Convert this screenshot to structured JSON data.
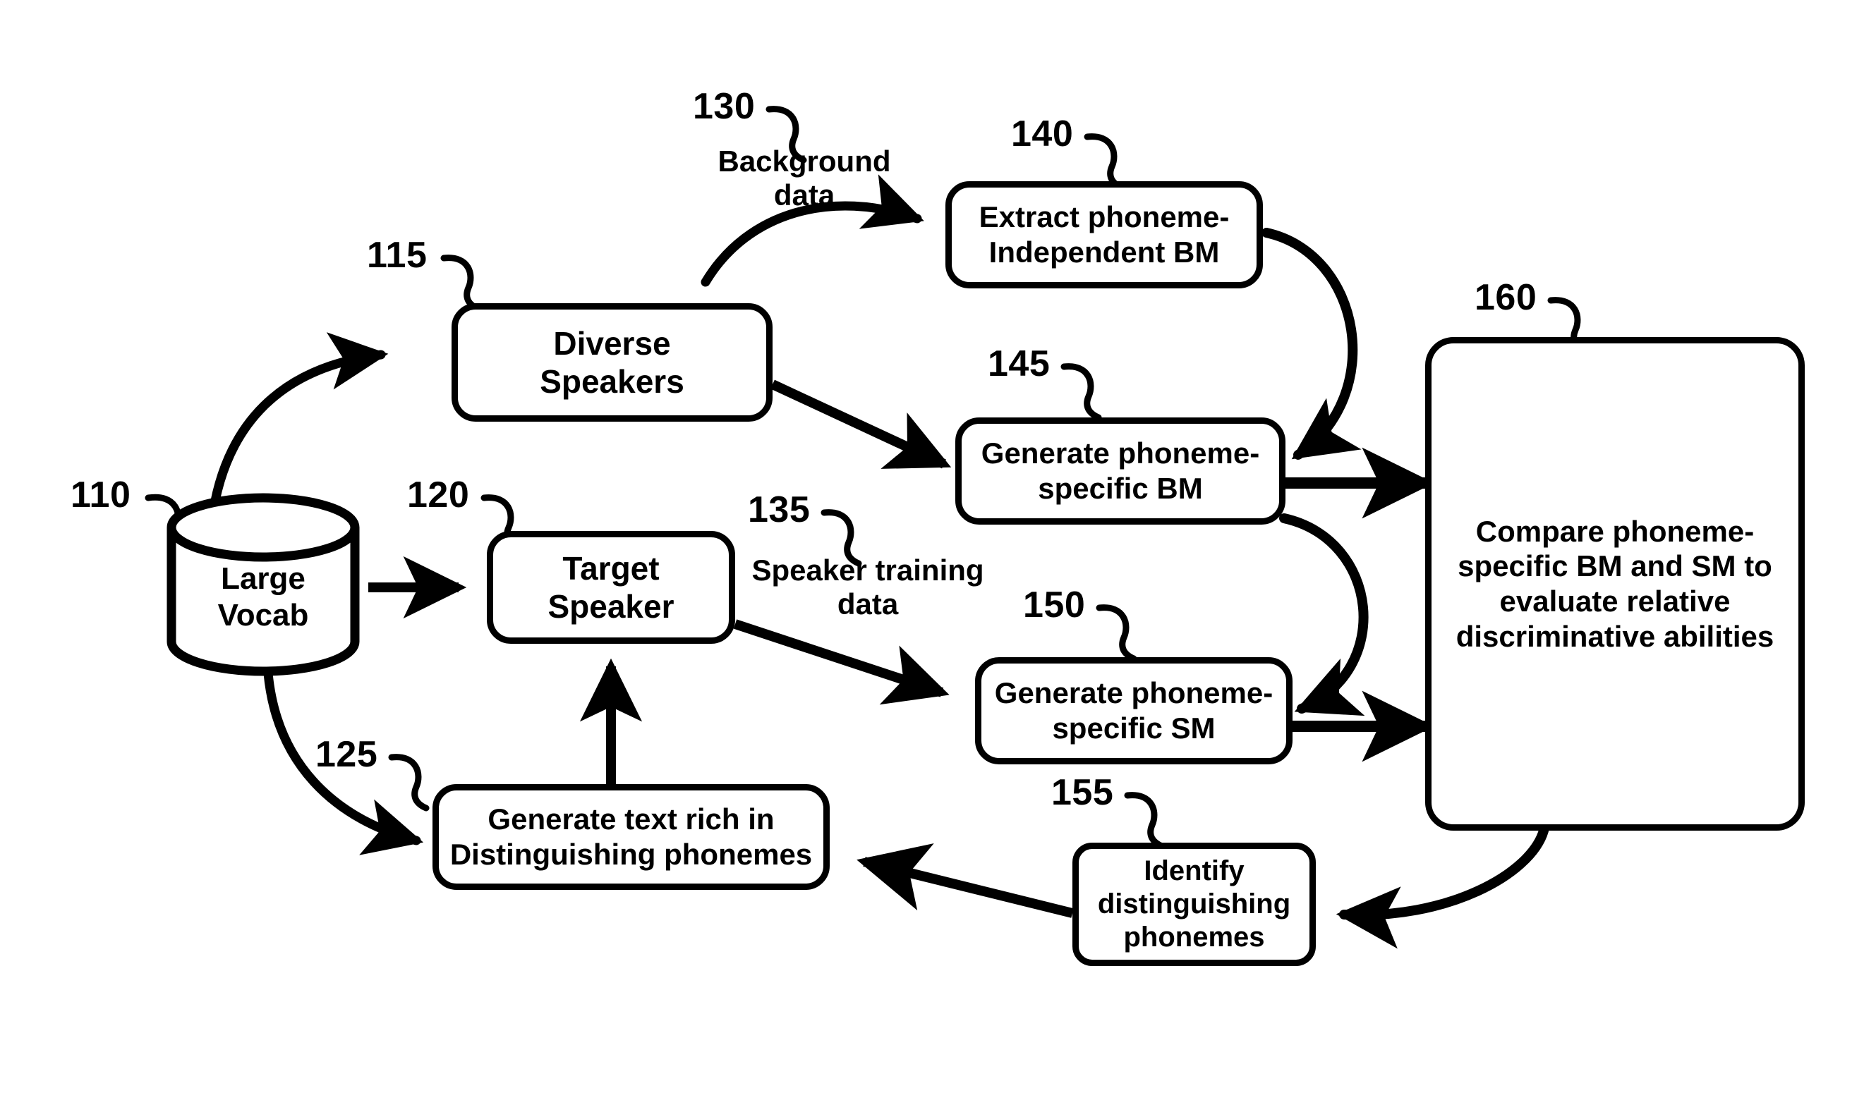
{
  "figure": {
    "title": "Speaker model comparison process flow"
  },
  "nodes": {
    "large_vocab": {
      "ref": "110",
      "label": "Large\nVocab",
      "shape": "cylinder"
    },
    "diverse_speakers": {
      "ref": "115",
      "label": "Diverse\nSpeakers",
      "shape": "rounded-rect"
    },
    "target_speaker": {
      "ref": "120",
      "label": "Target\nSpeaker",
      "shape": "rounded-rect"
    },
    "generate_text": {
      "ref": "125",
      "label": "Generate text rich in\nDistinguishing phonemes",
      "shape": "rounded-rect"
    },
    "extract_bm": {
      "ref": "140",
      "label": "Extract phoneme-\nIndependent BM",
      "shape": "rounded-rect"
    },
    "generate_bm": {
      "ref": "145",
      "label": "Generate phoneme-\nspecific BM",
      "shape": "rounded-rect"
    },
    "generate_sm": {
      "ref": "150",
      "label": "Generate phoneme-\nspecific SM",
      "shape": "rounded-rect"
    },
    "identify_phonemes": {
      "ref": "155",
      "label": "Identify\ndistinguishing\nphonemes",
      "shape": "rounded-rect"
    },
    "compare": {
      "ref": "160",
      "label": "Compare phoneme-\nspecific BM and SM to\nevaluate relative\ndiscriminative abilities",
      "shape": "rounded-rect"
    }
  },
  "edge_labels": {
    "background_data": {
      "ref": "130",
      "label": "Background\ndata"
    },
    "speaker_training_data": {
      "ref": "135",
      "label": "Speaker training\ndata"
    }
  },
  "colors": {
    "stroke": "#000000",
    "background": "#ffffff"
  }
}
